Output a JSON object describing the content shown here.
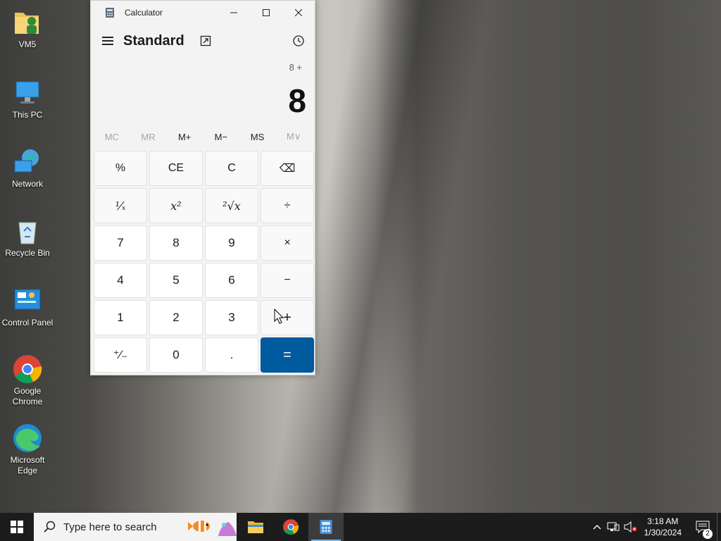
{
  "desktop": {
    "icons": [
      {
        "label": "VM5"
      },
      {
        "label": "This PC"
      },
      {
        "label": "Network"
      },
      {
        "label": "Recycle Bin"
      },
      {
        "label": "Control Panel"
      },
      {
        "label": "Google Chrome"
      },
      {
        "label": "Microsoft Edge"
      }
    ]
  },
  "calculator": {
    "title": "Calculator",
    "mode": "Standard",
    "expression": "8 +",
    "display": "8",
    "memory": [
      "MC",
      "MR",
      "M+",
      "M−",
      "MS",
      "M∨"
    ],
    "keys": [
      {
        "label": "%",
        "kind": "fn"
      },
      {
        "label": "CE",
        "kind": "fn"
      },
      {
        "label": "C",
        "kind": "fn"
      },
      {
        "label": "⌫",
        "kind": "fn"
      },
      {
        "label": "¹⁄ₓ",
        "kind": "fn"
      },
      {
        "label": "x²",
        "kind": "fn"
      },
      {
        "label": "²√x",
        "kind": "fn"
      },
      {
        "label": "÷",
        "kind": "fn"
      },
      {
        "label": "7",
        "kind": "num"
      },
      {
        "label": "8",
        "kind": "num"
      },
      {
        "label": "9",
        "kind": "num"
      },
      {
        "label": "×",
        "kind": "fn"
      },
      {
        "label": "4",
        "kind": "num"
      },
      {
        "label": "5",
        "kind": "num"
      },
      {
        "label": "6",
        "kind": "num"
      },
      {
        "label": "−",
        "kind": "fn"
      },
      {
        "label": "1",
        "kind": "num"
      },
      {
        "label": "2",
        "kind": "num"
      },
      {
        "label": "3",
        "kind": "num"
      },
      {
        "label": "+",
        "kind": "fn"
      },
      {
        "label": "⁺⁄₋",
        "kind": "num"
      },
      {
        "label": "0",
        "kind": "num"
      },
      {
        "label": ".",
        "kind": "num"
      },
      {
        "label": "=",
        "kind": "eq"
      }
    ]
  },
  "taskbar": {
    "search_placeholder": "Type here to search",
    "time": "3:18 AM",
    "date": "1/30/2024",
    "notification_count": "2"
  },
  "colors": {
    "accent": "#005a9e",
    "taskbar": "#1c1c1c"
  }
}
